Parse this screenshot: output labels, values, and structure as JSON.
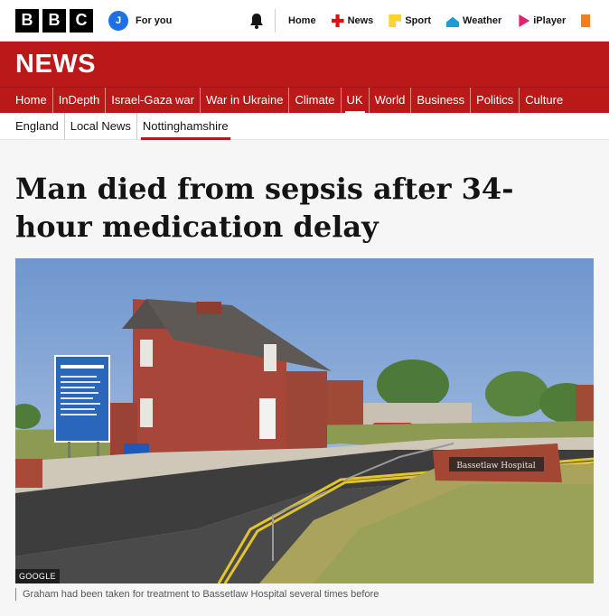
{
  "brand": {
    "logo_letters": [
      "B",
      "B",
      "C"
    ]
  },
  "account": {
    "initial": "J",
    "label": "For you"
  },
  "top_nav": [
    {
      "label": "Home",
      "icon": ""
    },
    {
      "label": "News",
      "icon": "news-icon"
    },
    {
      "label": "Sport",
      "icon": "sport-icon"
    },
    {
      "label": "Weather",
      "icon": "weather-icon"
    },
    {
      "label": "iPlayer",
      "icon": "iplayer-icon"
    }
  ],
  "section_title": "NEWS",
  "sections": [
    {
      "label": "Home",
      "active": false
    },
    {
      "label": "InDepth",
      "active": false
    },
    {
      "label": "Israel-Gaza war",
      "active": false
    },
    {
      "label": "War in Ukraine",
      "active": false
    },
    {
      "label": "Climate",
      "active": false
    },
    {
      "label": "UK",
      "active": true
    },
    {
      "label": "World",
      "active": false
    },
    {
      "label": "Business",
      "active": false
    },
    {
      "label": "Politics",
      "active": false
    },
    {
      "label": "Culture",
      "active": false
    }
  ],
  "subsections": [
    {
      "label": "England",
      "active": false
    },
    {
      "label": "Local News",
      "active": false
    },
    {
      "label": "Nottinghamshire",
      "active": true
    }
  ],
  "article": {
    "headline": "Man died from sepsis after 34-hour medication delay",
    "image": {
      "credit": "GOOGLE",
      "sign_text": "Bassetlaw Hospital",
      "caption": "Graham had been taken for treatment to Bassetlaw Hospital several times before"
    }
  },
  "colors": {
    "brand_red": "#bb1919",
    "account_blue": "#1f6fe5"
  }
}
